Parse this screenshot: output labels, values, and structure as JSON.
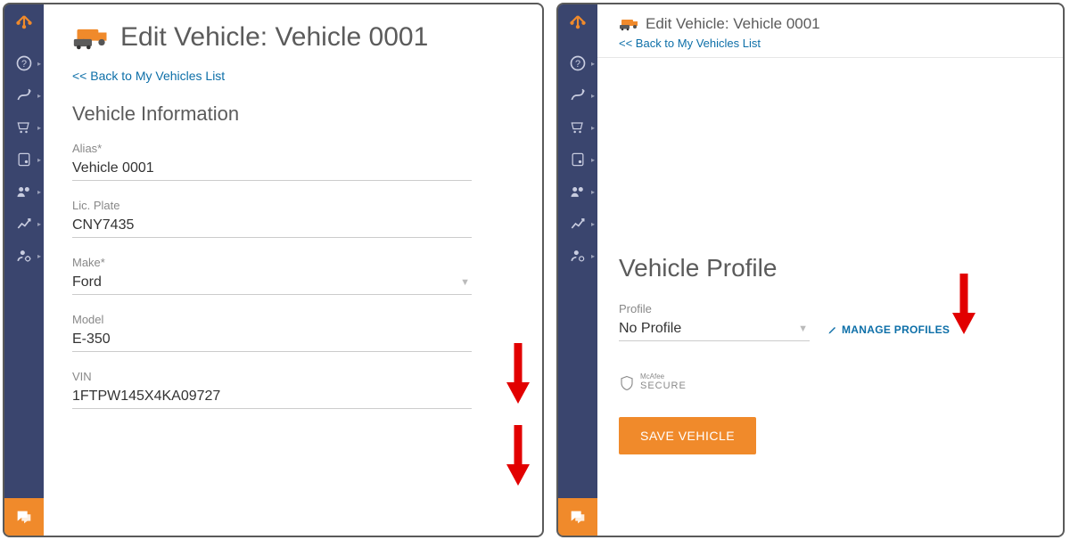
{
  "header": {
    "title": "Edit Vehicle: Vehicle 0001",
    "back_link": "<< Back to My Vehicles List"
  },
  "vehicle_info": {
    "section_label": "Vehicle Information",
    "fields": {
      "alias": {
        "label": "Alias*",
        "value": "Vehicle 0001"
      },
      "plate": {
        "label": "Lic. Plate",
        "value": "CNY7435"
      },
      "make": {
        "label": "Make*",
        "value": "Ford"
      },
      "model": {
        "label": "Model",
        "value": "E-350"
      },
      "vin": {
        "label": "VIN",
        "value": "1FTPW145X4KA09727"
      }
    }
  },
  "vehicle_profile": {
    "section_label": "Vehicle Profile",
    "profile_label": "Profile",
    "profile_value": "No Profile",
    "manage_label": "MANAGE PROFILES"
  },
  "security_badge": {
    "brand_small": "McAfee",
    "brand_big": "SECURE"
  },
  "buttons": {
    "save": "SAVE VEHICLE"
  },
  "colors": {
    "accent": "#f08a2b",
    "link": "#0d6fa8",
    "sidebar": "#3a456e",
    "arrow": "#e20000"
  }
}
